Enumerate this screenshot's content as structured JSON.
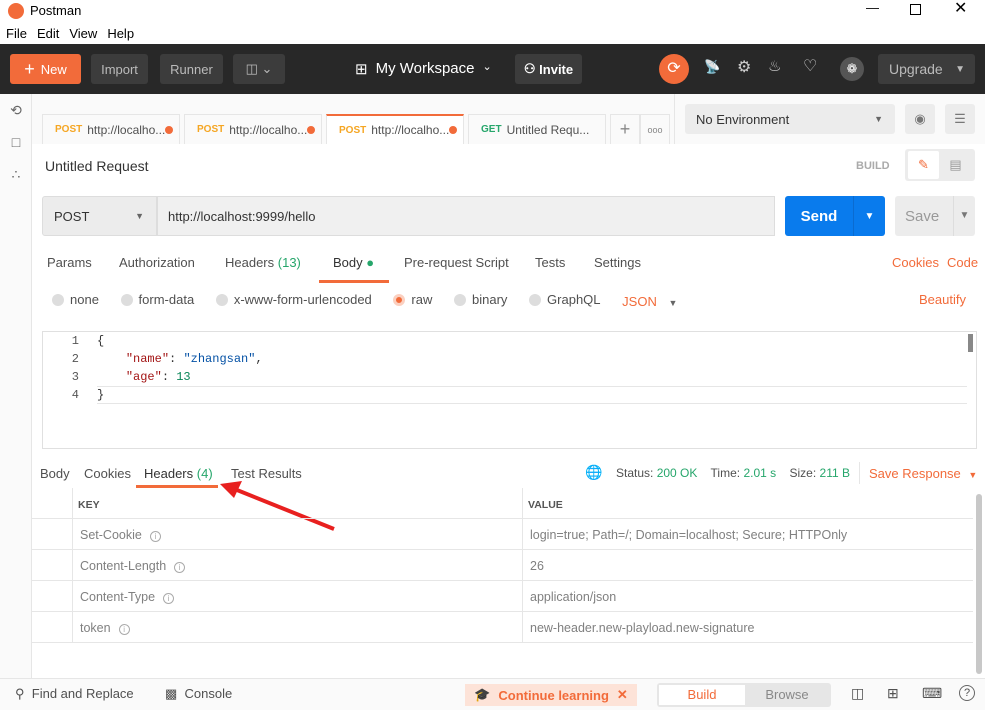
{
  "window": {
    "title": "Postman",
    "controls": [
      "minimize",
      "maximize",
      "close"
    ]
  },
  "menu": [
    "File",
    "Edit",
    "View",
    "Help"
  ],
  "toolbar": {
    "new": "New",
    "import": "Import",
    "runner": "Runner",
    "workspace": "My Workspace",
    "invite": "Invite",
    "upgrade": "Upgrade"
  },
  "tabs": [
    {
      "method": "POST",
      "label": "http://localho...",
      "unsaved": true
    },
    {
      "method": "POST",
      "label": "http://localho...",
      "unsaved": true
    },
    {
      "method": "POST",
      "label": "http://localho...",
      "unsaved": true,
      "active": true
    },
    {
      "method": "GET",
      "label": "Untitled Requ...",
      "unsaved": false
    }
  ],
  "environment": {
    "selected": "No Environment"
  },
  "request": {
    "title": "Untitled Request",
    "mode": "BUILD",
    "method": "POST",
    "url": "http://localhost:9999/hello",
    "send": "Send",
    "save": "Save",
    "subtabs": [
      "Params",
      "Authorization",
      "Headers",
      "Body",
      "Pre-request Script",
      "Tests",
      "Settings"
    ],
    "headers_count": "(13)",
    "active_subtab": "Body",
    "cookies": "Cookies",
    "code": "Code",
    "body_types": [
      "none",
      "form-data",
      "x-www-form-urlencoded",
      "raw",
      "binary",
      "GraphQL"
    ],
    "selected_body_type": "raw",
    "format": "JSON",
    "beautify": "Beautify",
    "code_lines": [
      "1",
      "2",
      "3",
      "4"
    ],
    "body": {
      "l1": "{",
      "k1": "\"name\"",
      "v1": "\"zhangsan\"",
      "k2": "\"age\"",
      "v2": "13",
      "l4": "}"
    }
  },
  "response": {
    "tabs": [
      "Body",
      "Cookies",
      "Headers",
      "Test Results"
    ],
    "headers_count": "(4)",
    "active_tab": "Headers",
    "status_label": "Status:",
    "status": "200 OK",
    "time_label": "Time:",
    "time": "2.01 s",
    "size_label": "Size:",
    "size": "211 B",
    "save_response": "Save Response",
    "columns": [
      "KEY",
      "VALUE"
    ],
    "rows": [
      {
        "key": "Set-Cookie",
        "value": "login=true; Path=/; Domain=localhost; Secure; HTTPOnly"
      },
      {
        "key": "Content-Length",
        "value": "26"
      },
      {
        "key": "Content-Type",
        "value": "application/json"
      },
      {
        "key": "token",
        "value": "new-header.new-playload.new-signature"
      }
    ]
  },
  "statusbar": {
    "find": "Find and Replace",
    "console": "Console",
    "learning": "Continue learning",
    "build": "Build",
    "browse": "Browse"
  },
  "colors": {
    "accent": "#f26b3a",
    "send": "#097bed",
    "success": "#26a66b",
    "toolbar": "#282828"
  }
}
